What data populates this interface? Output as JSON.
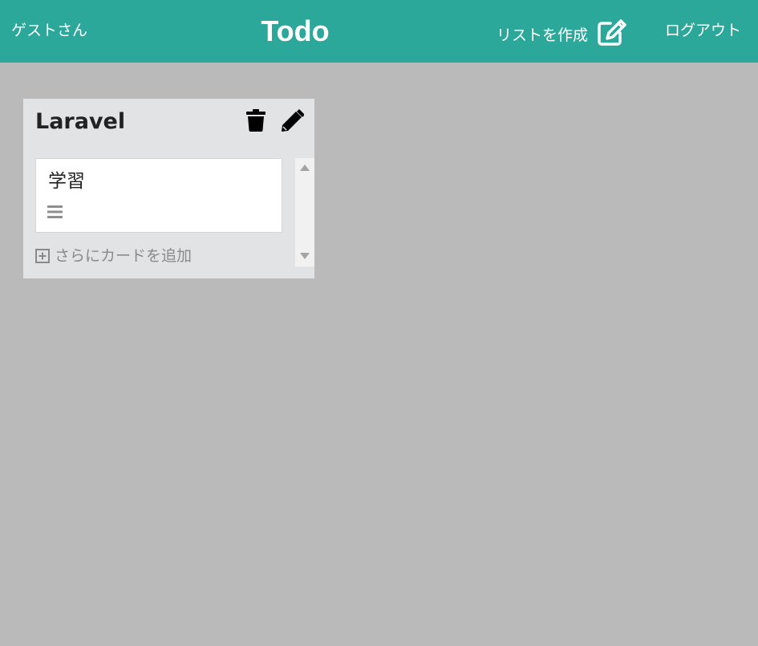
{
  "header": {
    "user_name": "ゲストさん",
    "title": "Todo",
    "create_list_label": "リストを作成",
    "logout_label": "ログアウト",
    "background_color": "#2ca89a"
  },
  "board": {
    "background_color": "#bababa",
    "lists": [
      {
        "title": "Laravel",
        "cards": [
          {
            "title": "学習",
            "has_description": true
          }
        ],
        "add_card_label": "さらにカードを追加"
      }
    ]
  },
  "icons": {
    "create_list": "edit-square-icon",
    "delete_list": "trash-icon",
    "edit_list": "pencil-icon",
    "card_description": "bars-icon",
    "add_card": "plus-square-icon"
  }
}
